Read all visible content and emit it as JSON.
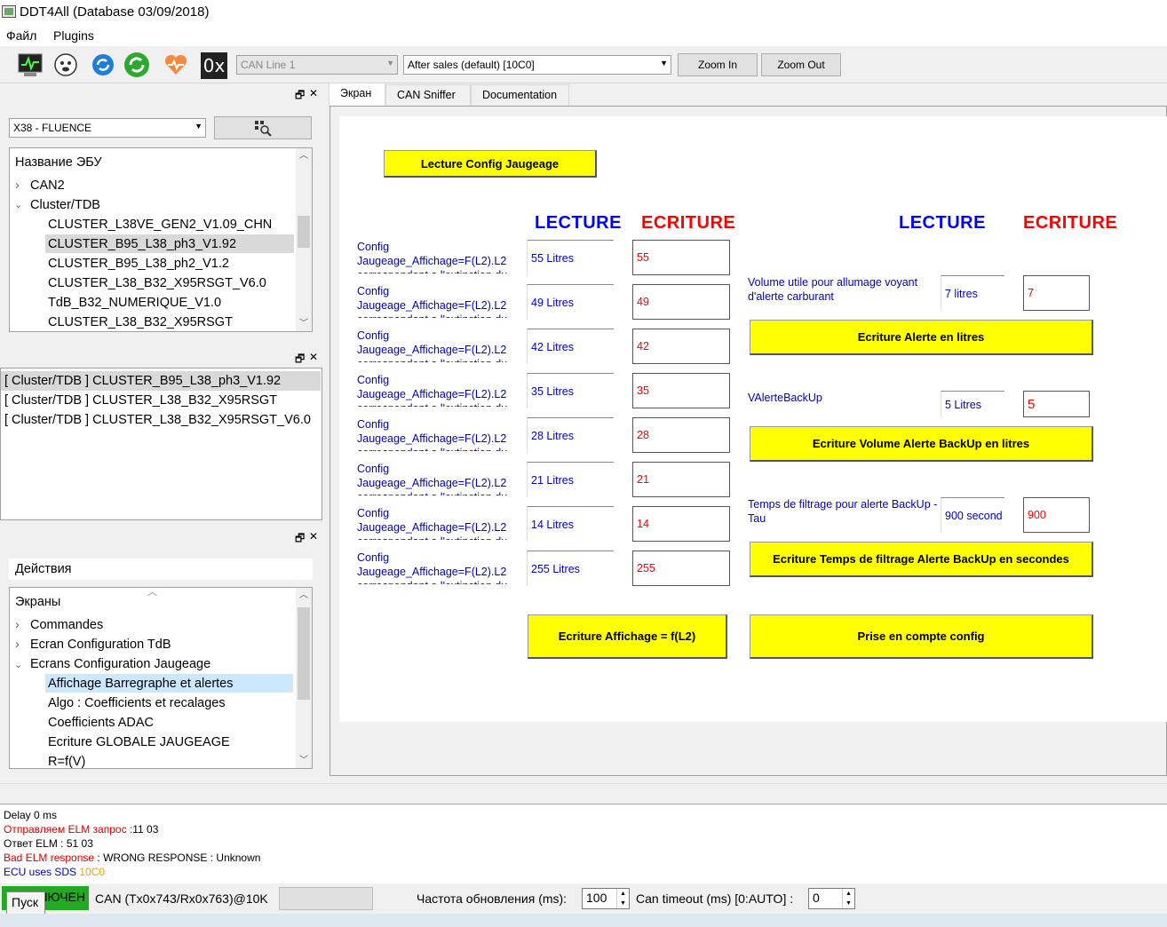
{
  "app": {
    "title": "DDT4All (Database 03/09/2018)"
  },
  "menu": [
    "Файл",
    "Plugins"
  ],
  "toolbar": {
    "icons": [
      "monitor-icon",
      "dog-sniffer-icon",
      "refresh-icon",
      "green-refresh-icon",
      "heartbeat-icon",
      "hex-0x-icon"
    ],
    "hex_label": "0x",
    "can_line": "CAN Line 1",
    "session": "After sales (default) [10C0]",
    "zoom_in": "Zoom In",
    "zoom_out": "Zoom Out"
  },
  "vehicle": {
    "selected": "X38 - FLUENCE"
  },
  "ecu_tree": {
    "header": "Название ЭБУ",
    "items": [
      "CAN2",
      "Cluster/TDB",
      "CLUSTER_L38VE_GEN2_V1.09_CHN",
      "CLUSTER_B95_L38_ph3_V1.92",
      "CLUSTER_B95_L38_ph2_V1.2",
      "CLUSTER_L38_B32_X95RSGT_V6.0",
      "TdB_B32_NUMERIQUE_V1.0",
      "CLUSTER_L38_B32_X95RSGT"
    ]
  },
  "ecu_list": [
    "[ Cluster/TDB ] CLUSTER_B95_L38_ph3_V1.92",
    "[ Cluster/TDB ] CLUSTER_L38_B32_X95RSGT",
    "[ Cluster/TDB ] CLUSTER_L38_B32_X95RSGT_V6.0"
  ],
  "actions": {
    "title": "Действия",
    "header": "Экраны",
    "items": [
      "Commandes",
      "Ecran Configuration TdB",
      "Ecrans Configuration Jaugeage",
      "Affichage Barregraphe et alertes",
      "Algo : Coefficients et recalages",
      "Coefficients ADAC",
      "Ecriture GLOBALE JAUGEAGE",
      "R=f(V)"
    ]
  },
  "tabs": [
    "Экран",
    "CAN Sniffer",
    "Documentation"
  ],
  "screen": {
    "read_btn": "Lecture Config Jaugeage",
    "lecture": "LECTURE",
    "ecriture": "ECRITURE",
    "config_label_line1": "Config",
    "config_label_line2": "Jaugeage_Affichage=F(L2).L2",
    "config_label_line3": "correspondant a l'extinction du",
    "rows": [
      {
        "read": "55 Litres",
        "write": "55"
      },
      {
        "read": "49 Litres",
        "write": "49"
      },
      {
        "read": "42 Litres",
        "write": "42"
      },
      {
        "read": "35 Litres",
        "write": "35"
      },
      {
        "read": "28 Litres",
        "write": "28"
      },
      {
        "read": "21 Litres",
        "write": "21"
      },
      {
        "read": "14 Litres",
        "write": "14"
      },
      {
        "read": "255 Litres",
        "write": "255"
      }
    ],
    "write_affichage_btn": "Ecriture Affichage = f(L2)",
    "volume_label": "Volume utile pour allumage voyant d'alerte carburant",
    "volume_read": "7 litres",
    "volume_write": "7",
    "write_alerte_btn": "Ecriture Alerte en litres",
    "backup_label": "VAlerteBackUp",
    "backup_read": "5 Litres",
    "backup_write": "5",
    "write_backup_btn": "Ecriture Volume Alerte BackUp en litres",
    "temps_label": "Temps de filtrage pour alerte BackUp - Tau",
    "temps_read": "900 second",
    "temps_write": "900",
    "write_temps_btn": "Ecriture Temps de filtrage Alerte BackUp en secondes",
    "prise_btn": "Prise en compte config"
  },
  "log": {
    "l1": "Delay 0 ms",
    "l2a": "Отправляем ELM запрос :",
    "l2b": "11 03",
    "l3": "Ответ ELM : 51 03",
    "l4a": "Bad ELM response",
    "l4b": " : WRONG RESPONSE : Unknown",
    "l5a": "ECU uses SDS ",
    "l5b": "10C0"
  },
  "status": {
    "connected": "ПОДКЛЮЧЕН",
    "start_btn": "Пуск",
    "can_info": "CAN (Tx0x743/Rx0x763)@10K",
    "refresh_label": "Частота обновления (ms):",
    "refresh_value": "100",
    "timeout_label": "Can timeout (ms) [0:AUTO] :",
    "timeout_value": "0"
  },
  "colors": {
    "accent_yellow": "#ffff00",
    "lecture_blue": "#0000ff",
    "ecriture_red": "#ff0000",
    "connected_green": "#22aa22"
  }
}
